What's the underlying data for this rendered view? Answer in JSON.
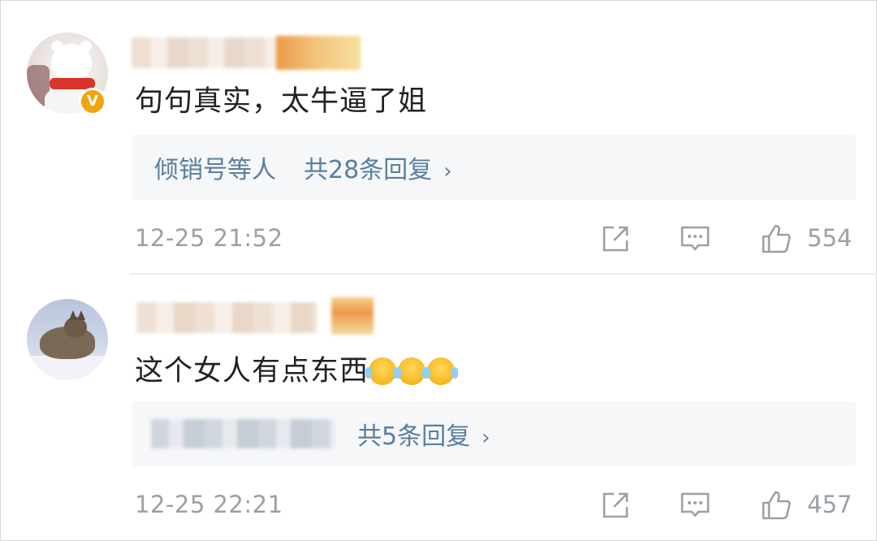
{
  "comments": [
    {
      "text": "句句真实，太牛逼了姐",
      "verified_badge": "V",
      "replies": {
        "names": "倾销号等人",
        "count_label": "共28条回复"
      },
      "time": "12-25 21:52",
      "likes": "554"
    },
    {
      "text": "这个女人有点东西",
      "emojis": [
        "crying-laughing-emoji",
        "crying-laughing-emoji",
        "crying-laughing-emoji"
      ],
      "replies": {
        "count_label": "共5条回复"
      },
      "time": "12-25 22:21",
      "likes": "457"
    }
  ],
  "icons": {
    "share": "share-icon",
    "comment": "comment-icon",
    "like": "thumbs-up-icon",
    "chevron": "›"
  },
  "colors": {
    "link": "#5a7ea0",
    "meta": "#9aa0a6",
    "badge": "#f2a40c"
  }
}
